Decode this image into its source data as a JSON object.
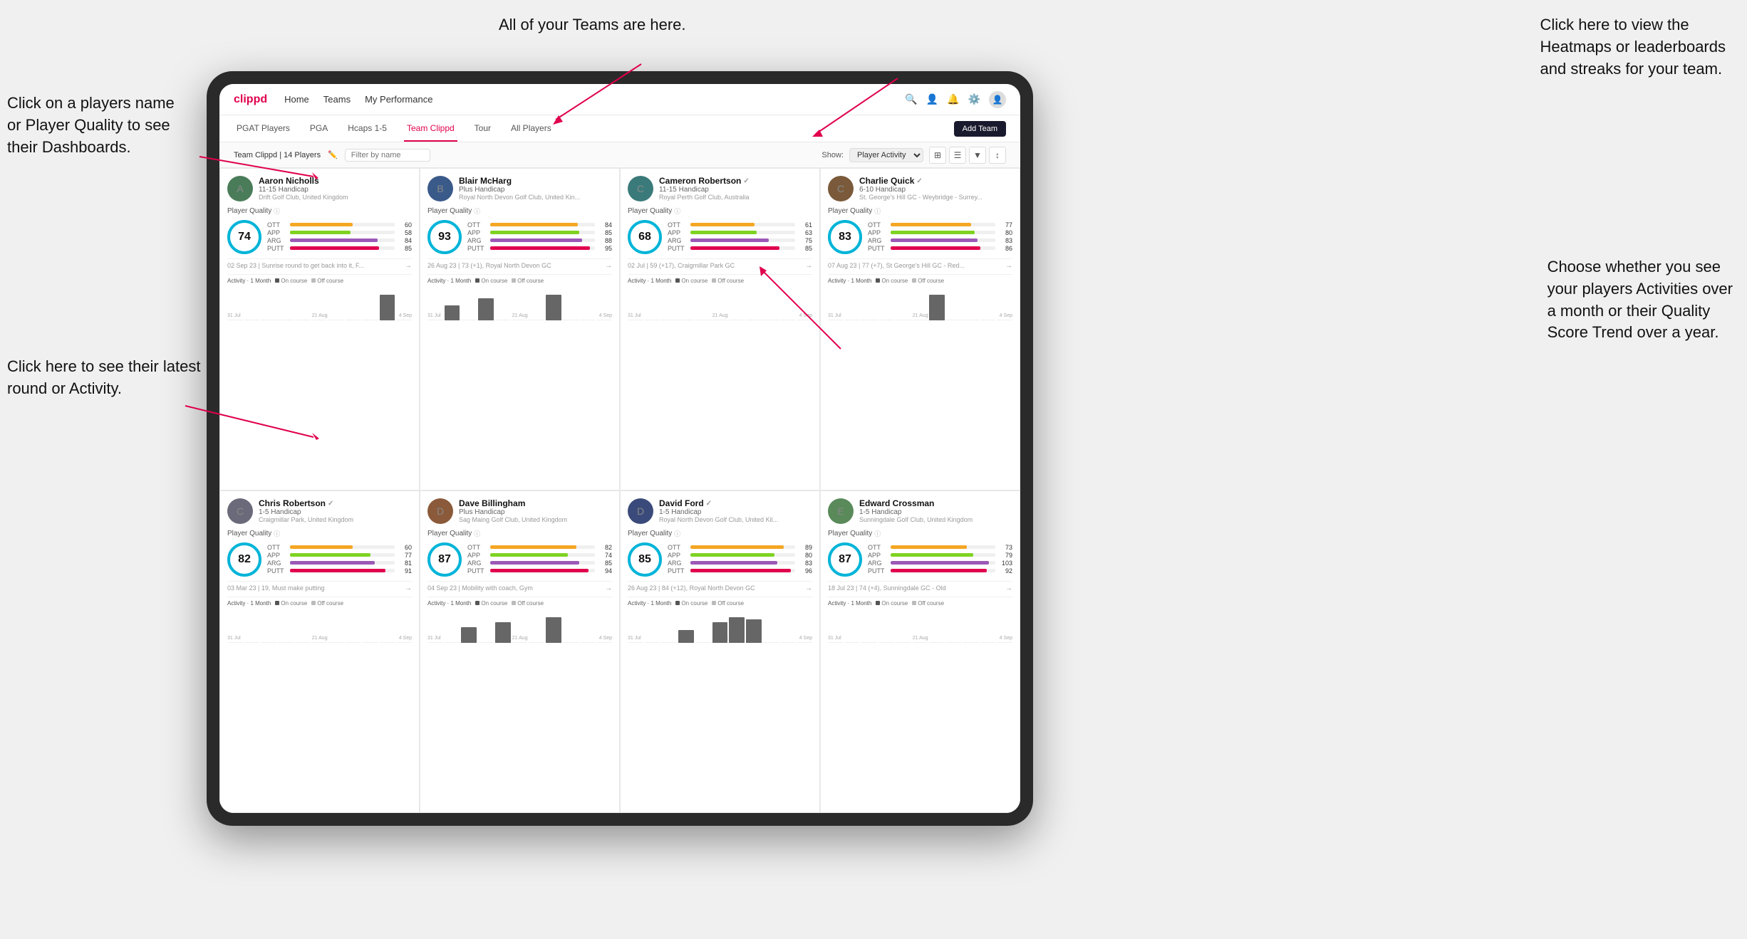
{
  "annotations": {
    "top_left": "Click on a players name\nor Player Quality to see\ntheir Dashboards.",
    "bottom_left": "Click here to see their latest\nround or Activity.",
    "top_center": "All of your Teams are here.",
    "top_right": "Click here to view the\nHeatmaps or leaderboards\nand streaks for your team.",
    "bottom_right": "Choose whether you see\nyour players Activities over\na month or their Quality\nScore Trend over a year."
  },
  "navbar": {
    "brand": "clippd",
    "links": [
      "Home",
      "Teams",
      "My Performance"
    ],
    "icons": [
      "search",
      "person",
      "bell",
      "settings",
      "avatar"
    ]
  },
  "subnav": {
    "tabs": [
      "PGAT Players",
      "PGA",
      "Hcaps 1-5",
      "Team Clippd",
      "Tour",
      "All Players"
    ],
    "active": "Team Clippd",
    "add_button": "Add Team"
  },
  "filterbar": {
    "team_label": "Team Clippd | 14 Players",
    "filter_placeholder": "Filter by name",
    "show_label": "Show:",
    "show_value": "Player Activity"
  },
  "players": [
    {
      "name": "Aaron Nicholls",
      "handicap": "11-15 Handicap",
      "club": "Drift Golf Club, United Kingdom",
      "quality": 74,
      "quality_color": "#00b4d8",
      "stats": [
        {
          "label": "OTT",
          "color": "#f5a623",
          "value": 60,
          "max": 100
        },
        {
          "label": "APP",
          "color": "#7ed321",
          "value": 58,
          "max": 100
        },
        {
          "label": "ARG",
          "color": "#9b59b6",
          "value": 84,
          "max": 100
        },
        {
          "label": "PUTT",
          "color": "#e0004d",
          "value": 85,
          "max": 100
        }
      ],
      "last_round": "02 Sep 23 | Sunrise round to get back into it, F...",
      "bars": [
        0,
        0,
        0,
        0,
        0,
        0,
        0,
        0,
        0,
        12,
        0
      ],
      "dates": [
        "31 Jul",
        "21 Aug",
        "4 Sep"
      ],
      "avatar_color": "av-green",
      "avatar_letter": "A",
      "verified": false
    },
    {
      "name": "Blair McHarg",
      "handicap": "Plus Handicap",
      "club": "Royal North Devon Golf Club, United Kin...",
      "quality": 93,
      "quality_color": "#00b4d8",
      "stats": [
        {
          "label": "OTT",
          "color": "#f5a623",
          "value": 84,
          "max": 100
        },
        {
          "label": "APP",
          "color": "#7ed321",
          "value": 85,
          "max": 100
        },
        {
          "label": "ARG",
          "color": "#9b59b6",
          "value": 88,
          "max": 100
        },
        {
          "label": "PUTT",
          "color": "#e0004d",
          "value": 95,
          "max": 100
        }
      ],
      "last_round": "26 Aug 23 | 73 (+1), Royal North Devon GC",
      "bars": [
        0,
        8,
        0,
        12,
        0,
        0,
        0,
        14,
        0,
        0,
        0
      ],
      "dates": [
        "31 Jul",
        "21 Aug",
        "4 Sep"
      ],
      "avatar_color": "av-blue",
      "avatar_letter": "B",
      "verified": false
    },
    {
      "name": "Cameron Robertson",
      "handicap": "11-15 Handicap",
      "club": "Royal Perth Golf Club, Australia",
      "quality": 68,
      "quality_color": "#00b4d8",
      "stats": [
        {
          "label": "OTT",
          "color": "#f5a623",
          "value": 61,
          "max": 100
        },
        {
          "label": "APP",
          "color": "#7ed321",
          "value": 63,
          "max": 100
        },
        {
          "label": "ARG",
          "color": "#9b59b6",
          "value": 75,
          "max": 100
        },
        {
          "label": "PUTT",
          "color": "#e0004d",
          "value": 85,
          "max": 100
        }
      ],
      "last_round": "02 Jul | 59 (+17), Craigmillar Park GC",
      "bars": [
        0,
        0,
        0,
        0,
        0,
        0,
        0,
        0,
        0,
        0,
        0
      ],
      "dates": [
        "31 Jul",
        "21 Aug",
        "4 Sep"
      ],
      "avatar_color": "av-teal",
      "avatar_letter": "C",
      "verified": true
    },
    {
      "name": "Charlie Quick",
      "handicap": "6-10 Handicap",
      "club": "St. George's Hill GC - Weybridge - Surrey...",
      "quality": 83,
      "quality_color": "#00b4d8",
      "stats": [
        {
          "label": "OTT",
          "color": "#f5a623",
          "value": 77,
          "max": 100
        },
        {
          "label": "APP",
          "color": "#7ed321",
          "value": 80,
          "max": 100
        },
        {
          "label": "ARG",
          "color": "#9b59b6",
          "value": 83,
          "max": 100
        },
        {
          "label": "PUTT",
          "color": "#e0004d",
          "value": 86,
          "max": 100
        }
      ],
      "last_round": "07 Aug 23 | 77 (+7), St George's Hill GC - Red...",
      "bars": [
        0,
        0,
        0,
        0,
        0,
        0,
        8,
        0,
        0,
        0,
        0
      ],
      "dates": [
        "31 Jul",
        "21 Aug",
        "4 Sep"
      ],
      "avatar_color": "av-brown",
      "avatar_letter": "C",
      "verified": true
    },
    {
      "name": "Chris Robertson",
      "handicap": "1-5 Handicap",
      "club": "Craigmillar Park, United Kingdom",
      "quality": 82,
      "quality_color": "#00b4d8",
      "stats": [
        {
          "label": "OTT",
          "color": "#f5a623",
          "value": 60,
          "max": 100
        },
        {
          "label": "APP",
          "color": "#7ed321",
          "value": 77,
          "max": 100
        },
        {
          "label": "ARG",
          "color": "#9b59b6",
          "value": 81,
          "max": 100
        },
        {
          "label": "PUTT",
          "color": "#e0004d",
          "value": 91,
          "max": 100
        }
      ],
      "last_round": "03 Mar 23 | 19, Must make putting",
      "bars": [
        0,
        0,
        0,
        0,
        0,
        0,
        0,
        0,
        0,
        0,
        0
      ],
      "dates": [
        "31 Jul",
        "21 Aug",
        "4 Sep"
      ],
      "avatar_color": "av-gray",
      "avatar_letter": "C",
      "verified": true
    },
    {
      "name": "Dave Billingham",
      "handicap": "Plus Handicap",
      "club": "Sag Maing Golf Club, United Kingdom",
      "quality": 87,
      "quality_color": "#00b4d8",
      "stats": [
        {
          "label": "OTT",
          "color": "#f5a623",
          "value": 82,
          "max": 100
        },
        {
          "label": "APP",
          "color": "#7ed321",
          "value": 74,
          "max": 100
        },
        {
          "label": "ARG",
          "color": "#9b59b6",
          "value": 85,
          "max": 100
        },
        {
          "label": "PUTT",
          "color": "#e0004d",
          "value": 94,
          "max": 100
        }
      ],
      "last_round": "04 Sep 23 | Mobility with coach, Gym",
      "bars": [
        0,
        0,
        6,
        0,
        8,
        0,
        0,
        10,
        0,
        0,
        0
      ],
      "dates": [
        "31 Jul",
        "21 Aug",
        "4 Sep"
      ],
      "avatar_color": "av-orange",
      "avatar_letter": "D",
      "verified": false
    },
    {
      "name": "David Ford",
      "handicap": "1-5 Handicap",
      "club": "Royal North Devon Golf Club, United Kil...",
      "quality": 85,
      "quality_color": "#00b4d8",
      "stats": [
        {
          "label": "OTT",
          "color": "#f5a623",
          "value": 89,
          "max": 100
        },
        {
          "label": "APP",
          "color": "#7ed321",
          "value": 80,
          "max": 100
        },
        {
          "label": "ARG",
          "color": "#9b59b6",
          "value": 83,
          "max": 100
        },
        {
          "label": "PUTT",
          "color": "#e0004d",
          "value": 96,
          "max": 100
        }
      ],
      "last_round": "26 Aug 23 | 84 (+12), Royal North Devon GC",
      "bars": [
        0,
        0,
        0,
        10,
        0,
        16,
        20,
        18,
        0,
        0,
        0
      ],
      "dates": [
        "31 Jul",
        "21 Aug",
        "4 Sep"
      ],
      "avatar_color": "av-navy",
      "avatar_letter": "D",
      "verified": true
    },
    {
      "name": "Edward Crossman",
      "handicap": "1-5 Handicap",
      "club": "Sunningdale Golf Club, United Kingdom",
      "quality": 87,
      "quality_color": "#00b4d8",
      "stats": [
        {
          "label": "OTT",
          "color": "#f5a623",
          "value": 73,
          "max": 100
        },
        {
          "label": "APP",
          "color": "#7ed321",
          "value": 79,
          "max": 100
        },
        {
          "label": "ARG",
          "color": "#9b59b6",
          "value": 103,
          "max": 110
        },
        {
          "label": "PUTT",
          "color": "#e0004d",
          "value": 92,
          "max": 100
        }
      ],
      "last_round": "18 Jul 23 | 74 (+4), Sunningdale GC - Old",
      "bars": [
        0,
        0,
        0,
        0,
        0,
        0,
        0,
        0,
        0,
        0,
        0
      ],
      "dates": [
        "31 Jul",
        "21 Aug",
        "4 Sep"
      ],
      "avatar_color": "av-green2",
      "avatar_letter": "E",
      "verified": false
    }
  ]
}
